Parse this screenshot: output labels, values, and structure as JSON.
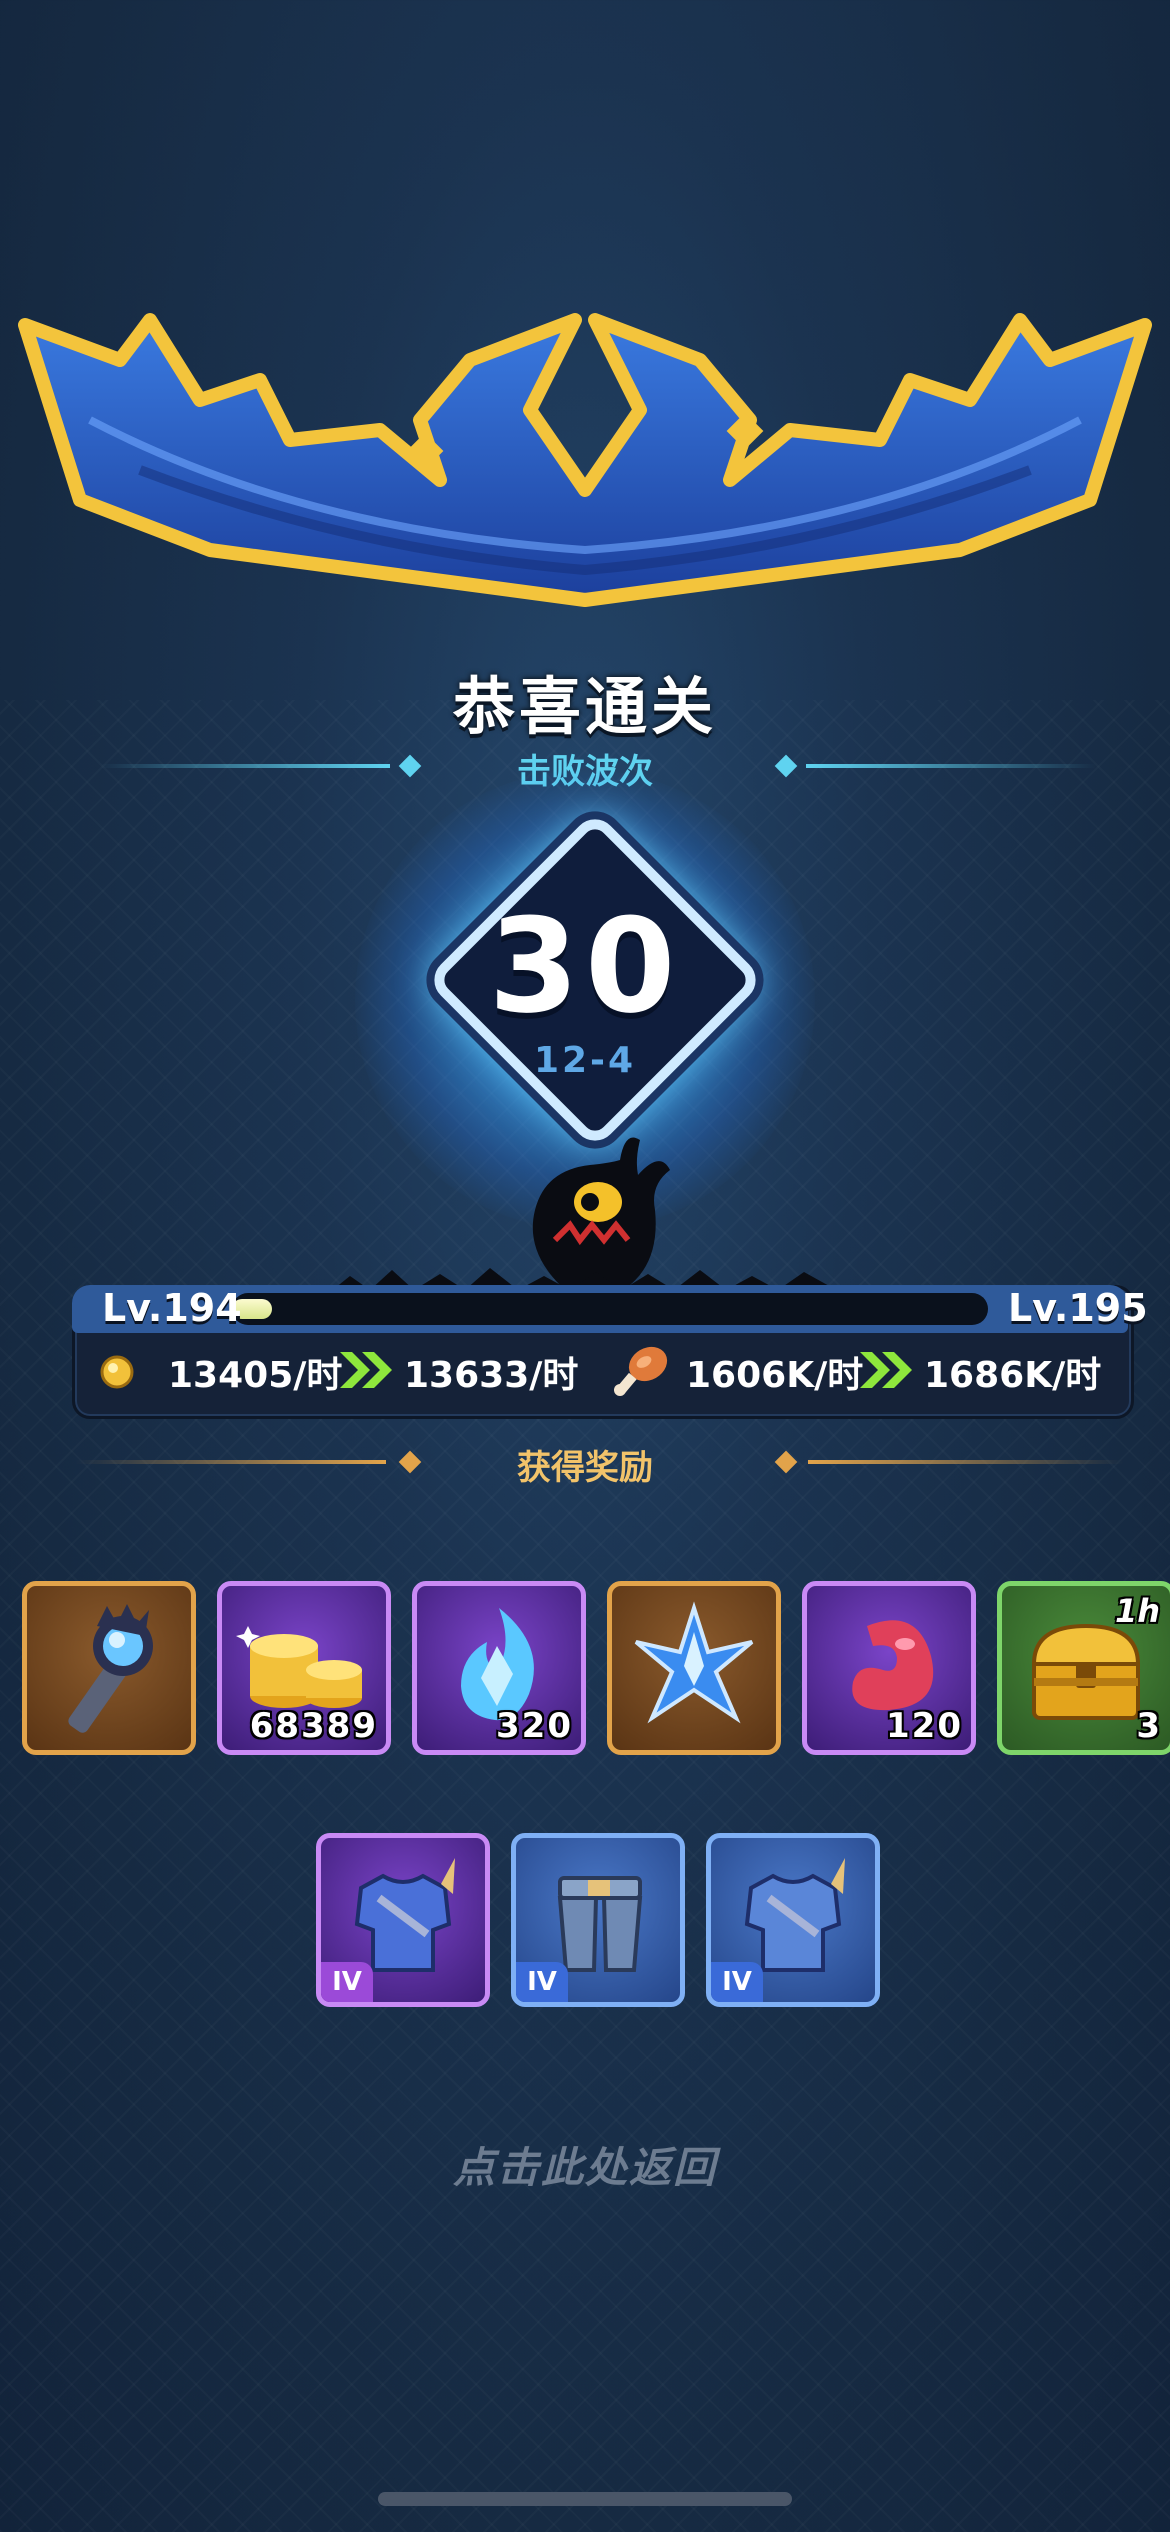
{
  "result": {
    "title": "恭喜通关",
    "wave_label": "击败波次",
    "wave_number": "30",
    "stage": "12-4"
  },
  "level": {
    "current": "Lv.194",
    "next": "Lv.195",
    "progress_fraction": 0.05
  },
  "income": {
    "gold_before": "13405/时",
    "gold_after": "13633/时",
    "food_before": "1606K/时",
    "food_after": "1686K/时"
  },
  "rewards_label": "获得奖励",
  "rewards": [
    {
      "icon": "dark-torch-icon",
      "quantity": "",
      "rarity": "gold"
    },
    {
      "icon": "gold-coins-icon",
      "quantity": "68389",
      "rarity": "purple"
    },
    {
      "icon": "blue-flame-crystal-icon",
      "quantity": "320",
      "rarity": "purple"
    },
    {
      "icon": "blue-star-shard-icon",
      "quantity": "",
      "rarity": "gold"
    },
    {
      "icon": "red-bean-icon",
      "quantity": "120",
      "rarity": "purple"
    },
    {
      "icon": "golden-chest-icon",
      "quantity": "3",
      "rarity": "green",
      "badge": "1h"
    }
  ],
  "equipment": [
    {
      "icon": "purple-chest-armor-icon",
      "tier": "IV",
      "rarity": "purple"
    },
    {
      "icon": "blue-leg-armor-icon",
      "tier": "IV",
      "rarity": "blue"
    },
    {
      "icon": "blue-chest-armor-icon",
      "tier": "IV",
      "rarity": "blue"
    }
  ],
  "return_hint": "点击此处返回",
  "colors": {
    "accent_cyan": "#5fd3f0",
    "gold_rarity": "#e2a34a",
    "purple_rarity": "#c98af5",
    "blue_rarity": "#7fb0f5",
    "green_rarity": "#7ed56a",
    "chevron_green": "#8ee63c"
  }
}
